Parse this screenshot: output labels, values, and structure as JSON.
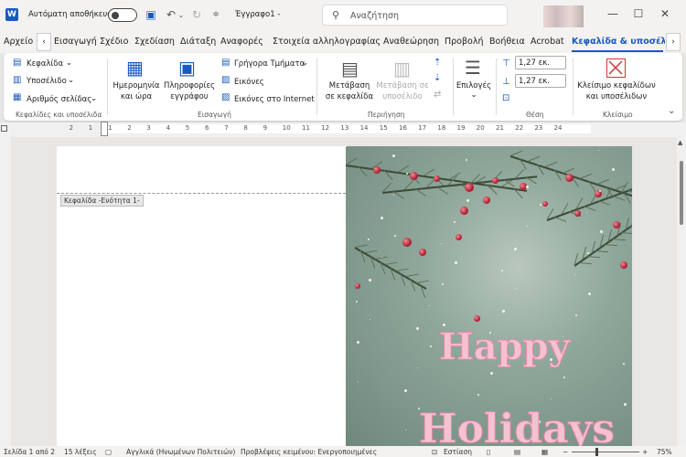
{
  "titlebar": {
    "autosave_label": "Αυτόματη αποθήκευση",
    "doc_name": "Έγγραφο1  -",
    "search_placeholder": "Αναζήτηση"
  },
  "menu": {
    "tabs": [
      "Αρχείο",
      "Εισαγωγή",
      "Σχέδιο",
      "Σχεδίαση",
      "Διάταξη",
      "Αναφορές",
      "Στοιχεία αλληλογραφίας",
      "Αναθεώρηση",
      "Προβολή",
      "Βοήθεια",
      "Acrobat",
      "Κεφαλίδα & υποσέλι"
    ],
    "active_tab": "Κεφαλίδα & υποσέλι"
  },
  "ribbon": {
    "header_label": "Κεφαλίδα",
    "footer_label": "Υποσέλιδο",
    "page_number_label": "Αριθμός σελίδας",
    "group_headers_footers": "Κεφαλίδες και υποσέλιδα",
    "date_time_label": [
      "Ημερομηνία",
      "και ώρα"
    ],
    "doc_info_label": [
      "Πληροφορίες",
      "εγγράφου"
    ],
    "quick_parts_label": "Γρήγορα Τμήματα",
    "pictures_label": "Εικόνες",
    "online_pictures_label": "Εικόνες στο Internet",
    "group_insert": "Εισαγωγή",
    "goto_header_label": [
      "Μετάβαση",
      "σε κεφαλίδα"
    ],
    "goto_footer_label": [
      "Μετάβαση σε",
      "υποσέλιδο"
    ],
    "group_navigation": "Περιήγηση",
    "options_label": "Επιλογές",
    "header_pos_value": "1,27 εκ.",
    "footer_pos_value": "1,27 εκ.",
    "group_position": "Θέση",
    "close_label": [
      "Κλείσιμο κεφαλίδων",
      "και υποσέλιδων"
    ],
    "group_close": "Κλείσιμο"
  },
  "ruler_numbers": [
    "2",
    "1",
    "1",
    "2",
    "3",
    "4",
    "5",
    "6",
    "7",
    "8",
    "9",
    "10",
    "11",
    "12",
    "13",
    "14",
    "15",
    "16",
    "17",
    "18",
    "19",
    "20",
    "21",
    "22",
    "23",
    "24"
  ],
  "document": {
    "header_tag": "Κεφαλίδα -Ενότητα 1-",
    "greeting_line1": "Happy",
    "greeting_line2": "Holidays"
  },
  "status": {
    "page": "Σελίδα 1 από 2",
    "words": "15 λέξεις",
    "language": "Αγγλικά (Ηνωμένων Πολιτειών)",
    "predictions": "Προβλέψεις κειμένου: Ενεργοποιημένες",
    "focus": "Εστίαση",
    "zoom": "75%"
  },
  "colors": {
    "accent": "#185abd",
    "ribbon_bg": "#ffffff",
    "chrome_bg": "#f3f2f1"
  }
}
